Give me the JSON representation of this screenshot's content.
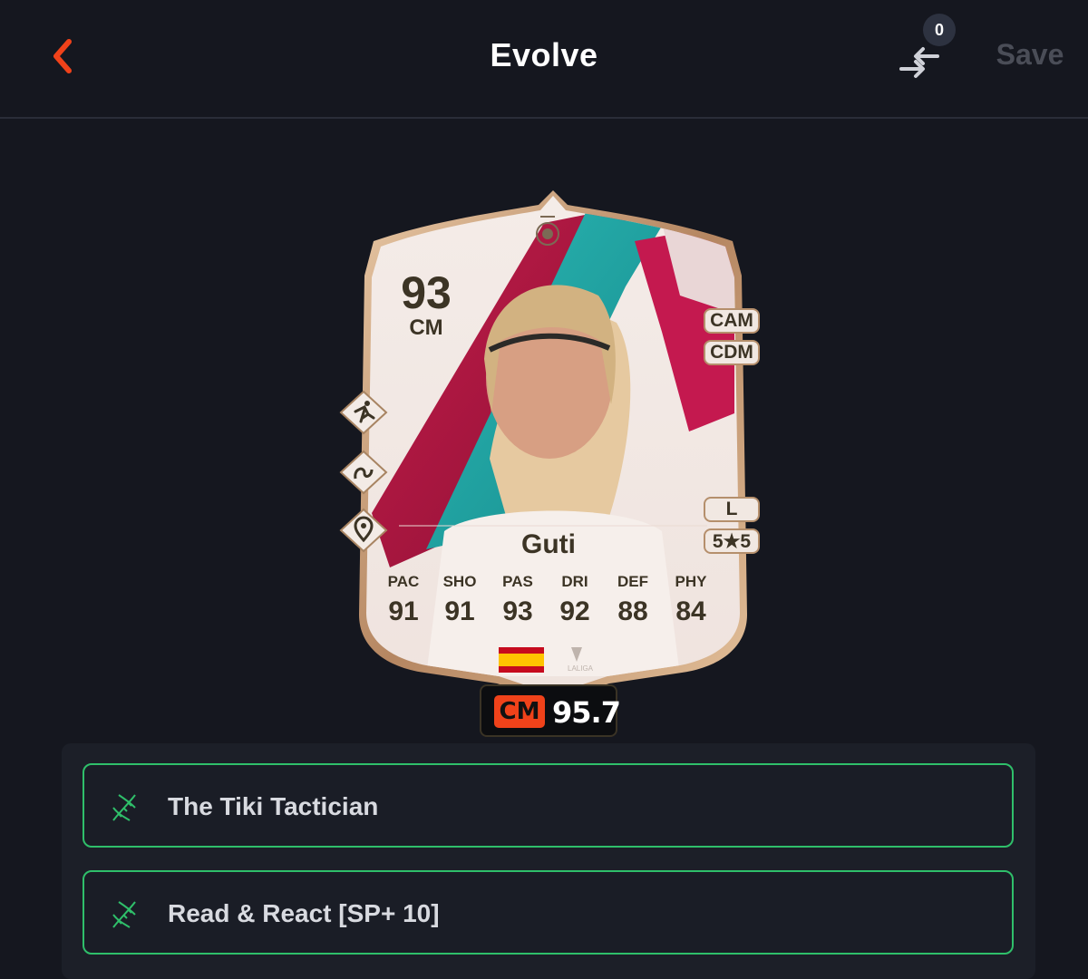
{
  "header": {
    "title": "Evolve",
    "compare_count": "0",
    "save_label": "Save"
  },
  "card": {
    "rating": "93",
    "position": "CM",
    "alt_positions": [
      "CAM",
      "CDM"
    ],
    "foot": "L",
    "skills_weakfoot": "5★5",
    "name": "Guti",
    "stats": [
      {
        "label": "PAC",
        "value": "91"
      },
      {
        "label": "SHO",
        "value": "91"
      },
      {
        "label": "PAS",
        "value": "93"
      },
      {
        "label": "DRI",
        "value": "92"
      },
      {
        "label": "DEF",
        "value": "88"
      },
      {
        "label": "PHY",
        "value": "84"
      }
    ],
    "nation": "Spain",
    "league_logo_text": "LALIGA"
  },
  "player_rating": {
    "position": "CM",
    "value": "95.7"
  },
  "evolutions": [
    {
      "label": "The Tiki Tactician"
    },
    {
      "label": "Read & React [SP+ 10]"
    }
  ],
  "colors": {
    "background": "#15171f",
    "accent": "#f0421a",
    "evo_border": "#2fbf6a"
  }
}
